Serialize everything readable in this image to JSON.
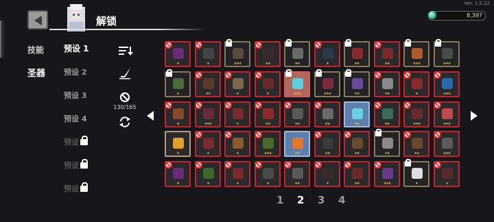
{
  "version": "Ver. 1.0.22",
  "header": {
    "title": "解锁",
    "back_icon": "back-arrow-icon",
    "avatar_icon": "white-hair-character-portrait"
  },
  "currency": {
    "amount": "8,397",
    "icon": "gem-icon"
  },
  "tabs": [
    {
      "label": "技能",
      "active": false
    },
    {
      "label": "圣器",
      "active": true
    }
  ],
  "presets": [
    {
      "label": "预设 1",
      "active": true,
      "locked": false
    },
    {
      "label": "预设 2",
      "active": false,
      "locked": false
    },
    {
      "label": "预设 3",
      "active": false,
      "locked": false
    },
    {
      "label": "预设 4",
      "active": false,
      "locked": false
    },
    {
      "label": "预设",
      "active": false,
      "locked": true
    },
    {
      "label": "预设",
      "active": false,
      "locked": true
    },
    {
      "label": "预设",
      "active": false,
      "locked": true
    }
  ],
  "tools": {
    "sort_icon": "sort-icon",
    "quill_icon": "quill-icon",
    "ban_icon": "ban-icon",
    "refresh_icon": "refresh-icon",
    "ban_count": "130/165"
  },
  "pagination": {
    "pages": [
      "1",
      "2",
      "3",
      "4"
    ],
    "current": "2"
  },
  "colors": {
    "ban_red": "#c8222a",
    "selected_blue": "#5e7fae",
    "star_gold": "#e8c23a"
  },
  "grid": {
    "rows": [
      [
        {
          "state": "ban",
          "stars": "★",
          "color": "#6a2a7a"
        },
        {
          "state": "ban",
          "stars": "★",
          "color": "#444444"
        },
        {
          "state": "lock",
          "stars": "★★★",
          "color": "#5a4a3a"
        },
        {
          "state": "ban",
          "stars": "★★",
          "color": "#3a2a2a"
        },
        {
          "state": "lock",
          "stars": "★★",
          "color": "#6a6a6a"
        },
        {
          "state": "ban",
          "stars": "★",
          "color": "#2a3a4a"
        },
        {
          "state": "lock",
          "stars": "★★",
          "color": "#8a2a2a"
        },
        {
          "state": "ban",
          "stars": "★★",
          "color": "#7a2a2a"
        },
        {
          "state": "lock",
          "stars": "★★★",
          "color": "#b05a2a"
        },
        {
          "state": "lock",
          "stars": "★★★",
          "color": "#4a4a4a"
        }
      ],
      [
        {
          "state": "lock",
          "stars": "★",
          "color": "#4a6a3a"
        },
        {
          "state": "ban",
          "stars": "★★",
          "color": "#5a3a2a"
        },
        {
          "state": "ban",
          "stars": "★",
          "color": "#7a6a4a"
        },
        {
          "state": "ban",
          "stars": "★",
          "color": "#6a2a2a"
        },
        {
          "state": "lock-hl",
          "stars": "★★★",
          "color": "#5ad0e0"
        },
        {
          "state": "lock",
          "stars": "★★★",
          "color": "#7a2a3a"
        },
        {
          "state": "lock",
          "stars": "★★",
          "color": "#6a4a9a"
        },
        {
          "state": "ban",
          "stars": "★★",
          "color": "#8a8a8a"
        },
        {
          "state": "ban",
          "stars": "★",
          "color": "#8a2a2a"
        },
        {
          "state": "ban",
          "stars": "★★★",
          "color": "#2a6aaa"
        }
      ],
      [
        {
          "state": "ban",
          "stars": "★",
          "color": "#8a4a2a"
        },
        {
          "state": "ban",
          "stars": "★★★",
          "color": "#6a2a3a"
        },
        {
          "state": "ban",
          "stars": "★",
          "color": "#7a2a2a"
        },
        {
          "state": "ban",
          "stars": "★★",
          "color": "#8a2a2a"
        },
        {
          "state": "ban",
          "stars": "★★",
          "color": "#5a5a5a"
        },
        {
          "state": "ban",
          "stars": "★★",
          "color": "#6a6a6a"
        },
        {
          "state": "selected",
          "stars": "★★",
          "color": "#6ad0e0"
        },
        {
          "state": "ban",
          "stars": "★★",
          "color": "#3a6a5a"
        },
        {
          "state": "ban",
          "stars": "★★★",
          "color": "#6a2a2a"
        },
        {
          "state": "ban",
          "stars": "★★★",
          "color": "#c04a4a"
        }
      ],
      [
        {
          "state": "gold",
          "stars": "★",
          "color": "#e0a02a"
        },
        {
          "state": "ban",
          "stars": "★",
          "color": "#7a2a2a"
        },
        {
          "state": "ban",
          "stars": "★",
          "color": "#8a5a2a"
        },
        {
          "state": "ban",
          "stars": "★★★",
          "color": "#4a6a2a"
        },
        {
          "state": "selected",
          "stars": "★★",
          "color": "#e07a2a"
        },
        {
          "state": "ban",
          "stars": "★★",
          "color": "#3a3a3a"
        },
        {
          "state": "ban",
          "stars": "★★",
          "color": "#6a4a2a"
        },
        {
          "state": "lock",
          "stars": "★★",
          "color": "#8a8a8a"
        },
        {
          "state": "ban",
          "stars": "★★",
          "color": "#6a4a2a"
        },
        {
          "state": "ban",
          "stars": "★★★",
          "color": "#5a5a5a"
        }
      ],
      [
        {
          "state": "ban",
          "stars": "★",
          "color": "#6a2a7a"
        },
        {
          "state": "ban",
          "stars": "★",
          "color": "#3a6a2a"
        },
        {
          "state": "ban",
          "stars": "★",
          "color": "#7a2a2a"
        },
        {
          "state": "ban",
          "stars": "★",
          "color": "#4a4a4a"
        },
        {
          "state": "ban",
          "stars": "★★",
          "color": "#5a5a5a"
        },
        {
          "state": "ban",
          "stars": "★",
          "color": "#3a2a2a"
        },
        {
          "state": "ban",
          "stars": "★★",
          "color": "#6a2a2a"
        },
        {
          "state": "ban",
          "stars": "★★★",
          "color": "#6a3a8a"
        },
        {
          "state": "lock",
          "stars": "★",
          "color": "#dddddd"
        },
        {
          "state": "ban",
          "stars": "★",
          "color": "#5a2a2a"
        }
      ]
    ]
  }
}
